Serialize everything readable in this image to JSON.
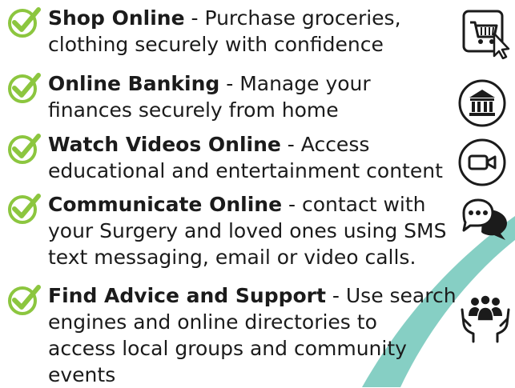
{
  "colors": {
    "check": "#8cc63f",
    "swoosh": "#86cfc4",
    "text": "#1b1b1b"
  },
  "items": [
    {
      "title": "Shop Online",
      "sep": " - ",
      "desc": [
        "Purchase groceries,",
        "clothing securely with confidence"
      ],
      "icon": "shopping-cart-icon"
    },
    {
      "title": "Online Banking",
      "sep": " - ",
      "desc": [
        "Manage your",
        "finances securely from home"
      ],
      "icon": "bank-icon"
    },
    {
      "title": "Watch Videos Online",
      "sep": " - ",
      "desc": [
        "Access",
        "educational and entertainment content"
      ],
      "icon": "video-camera-icon"
    },
    {
      "title": "Communicate Online",
      "sep": " - ",
      "desc": [
        "contact with",
        "your Surgery and loved ones using SMS",
        "text messaging, email or video calls."
      ],
      "icon": "chat-bubbles-icon"
    },
    {
      "title": "Find Advice and Support",
      "sep": " - ",
      "desc": [
        "Use search",
        "engines and online directories to",
        "access local groups and community",
        "events"
      ],
      "icon": "community-hands-icon"
    }
  ]
}
